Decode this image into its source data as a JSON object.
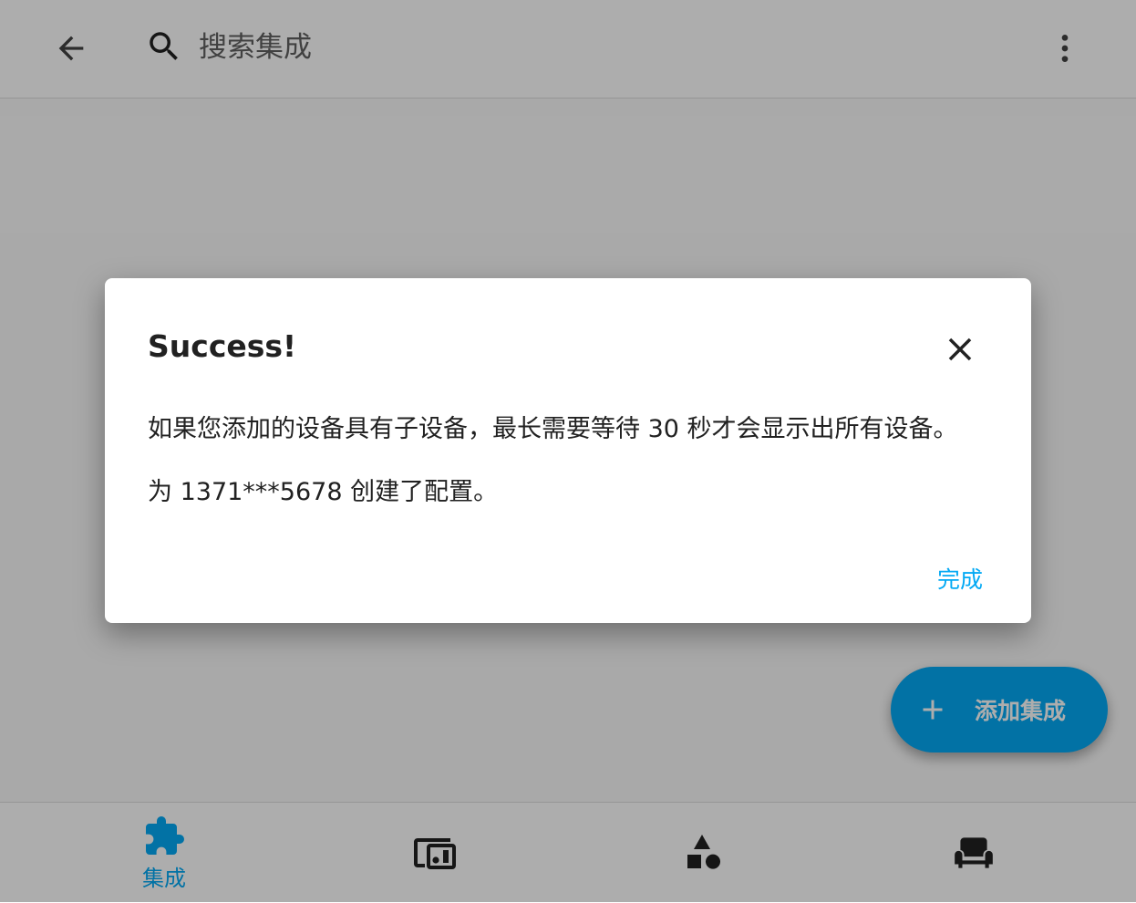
{
  "header": {
    "back_icon": "arrow-left-icon",
    "search_icon": "search-icon",
    "search_placeholder": "搜索集成",
    "menu_icon": "dots-vertical-icon"
  },
  "fab": {
    "icon": "plus-icon",
    "label": "添加集成"
  },
  "bottom_nav": {
    "items": [
      {
        "icon": "puzzle-icon",
        "label": "集成",
        "active": true
      },
      {
        "icon": "devices-icon",
        "label": "",
        "active": false
      },
      {
        "icon": "shapes-icon",
        "label": "",
        "active": false
      },
      {
        "icon": "sofa-icon",
        "label": "",
        "active": false
      }
    ]
  },
  "dialog": {
    "title": "Success!",
    "close_icon": "close-icon",
    "message_1": "如果您添加的设备具有子设备，最长需要等待 30 秒才会显示出所有设备。",
    "message_2": "为 1371***5678 创建了配置。",
    "done_label": "完成"
  },
  "colors": {
    "accent": "#03a9f4",
    "text": "#212121",
    "scrim": "rgba(0,0,0,0.32)"
  }
}
